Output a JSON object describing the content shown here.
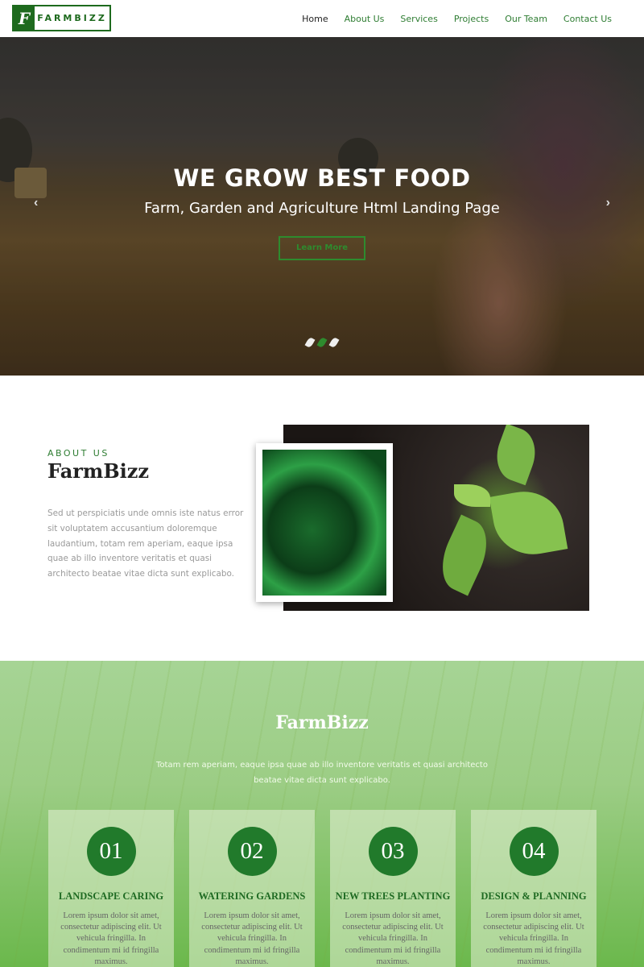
{
  "header": {
    "logo_mark": "F",
    "logo_text": "FARMBIZZ",
    "nav": [
      {
        "label": "Home",
        "active": true
      },
      {
        "label": "About Us"
      },
      {
        "label": "Services"
      },
      {
        "label": "Projects"
      },
      {
        "label": "Our Team"
      },
      {
        "label": "Contact Us"
      }
    ]
  },
  "hero": {
    "title": "WE GROW BEST FOOD",
    "subtitle": "Farm, Garden and Agriculture Html Landing Page",
    "button": "Learn More",
    "prev_icon": "‹",
    "next_icon": "›",
    "slides": 3,
    "active_slide": 2
  },
  "about": {
    "label": "ABOUT US",
    "title": "FarmBizz",
    "text": "Sed ut perspiciatis unde omnis iste natus error sit voluptatem accusantium doloremque laudantium, totam rem aperiam, eaque ipsa quae ab illo inventore veritatis et quasi architecto beatae vitae dicta sunt explicabo."
  },
  "services": {
    "title": "FarmBizz",
    "subtitle": "Totam rem aperiam, eaque ipsa quae ab illo inventore veritatis et quasi architecto beatae vitae dicta sunt explicabo.",
    "cards": [
      {
        "num": "01",
        "title": "LANDSCAPE CARING",
        "text": "Lorem ipsum dolor sit amet, consectetur adipiscing elit. Ut vehicula fringilla. In condimentum mi id fringilla maximus."
      },
      {
        "num": "02",
        "title": "WATERING GARDENS",
        "text": "Lorem ipsum dolor sit amet, consectetur adipiscing elit. Ut vehicula fringilla. In condimentum mi id fringilla maximus."
      },
      {
        "num": "03",
        "title": "NEW TREES PLANTING",
        "text": "Lorem ipsum dolor sit amet, consectetur adipiscing elit. Ut vehicula fringilla. In condimentum mi id fringilla maximus."
      },
      {
        "num": "04",
        "title": "DESIGN & PLANNING",
        "text": "Lorem ipsum dolor sit amet, consectetur adipiscing elit. Ut vehicula fringilla. In condimentum mi id fringilla maximus."
      }
    ]
  },
  "colors": {
    "brand": "#1e6a1e",
    "accent": "#2e8b2e",
    "circle": "#217a2b"
  }
}
